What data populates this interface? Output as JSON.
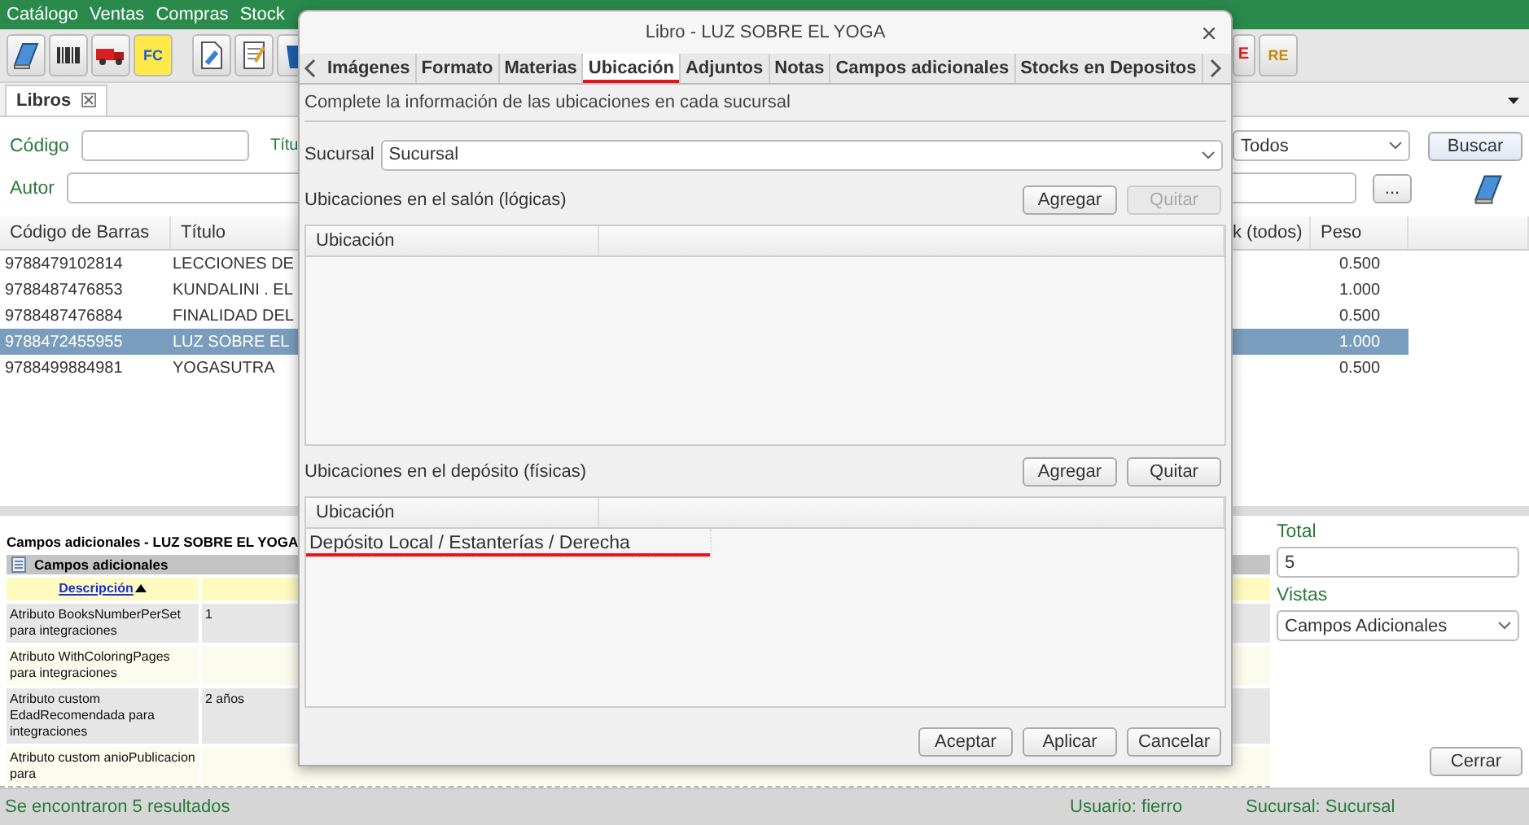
{
  "menu": [
    "Catálogo",
    "Ventas",
    "Compras",
    "Stock"
  ],
  "toolbar": {
    "fc_label": "FC",
    "pe_label": "E",
    "re_label": "RE"
  },
  "doc_tab": {
    "label": "Libros"
  },
  "search": {
    "code_label": "Código",
    "title_label": "Títu",
    "author_label": "Autor",
    "filter_value": "Todos",
    "search_button": "Buscar",
    "more_button": "..."
  },
  "results": {
    "columns": [
      "Código de Barras",
      "Título",
      "k (todos)",
      "Peso"
    ],
    "rows": [
      {
        "barcode": "9788479102814",
        "title": "LECCIONES DE",
        "weight": "0.500",
        "selected": false
      },
      {
        "barcode": "9788487476853",
        "title": "KUNDALINI . EL",
        "weight": "1.000",
        "selected": false
      },
      {
        "barcode": "9788487476884",
        "title": "FINALIDAD DEL",
        "weight": "0.500",
        "selected": false
      },
      {
        "barcode": "9788472455955",
        "title": "LUZ SOBRE EL",
        "weight": "1.000",
        "selected": true
      },
      {
        "barcode": "9788499884981",
        "title": "YOGASUTRA",
        "weight": "0.500",
        "selected": false
      }
    ]
  },
  "extra_fields": {
    "heading": "Campos adicionales - LUZ SOBRE EL YOGA",
    "group_title": "Campos adicionales",
    "column_header": "Descripción",
    "rows": [
      {
        "description": "Atributo BooksNumberPerSet para integraciones",
        "value": "1"
      },
      {
        "description": "Atributo WithColoringPages para integraciones",
        "value": ""
      },
      {
        "description": "Atributo custom EdadRecomendada para integraciones",
        "value": "2 años"
      },
      {
        "description": "Atributo custom anioPublicacion para",
        "value": ""
      }
    ]
  },
  "side_panel": {
    "total_label": "Total",
    "total_value": "5",
    "views_label": "Vistas",
    "views_value": "Campos Adicionales",
    "close_button": "Cerrar"
  },
  "status_bar": {
    "message": "Se encontraron 5 resultados",
    "user": "Usuario: fierro",
    "branch": "Sucursal: Sucursal"
  },
  "dialog": {
    "title": "Libro - LUZ SOBRE EL YOGA",
    "tabs": [
      {
        "label": "Imágenes",
        "selected": false,
        "annotated": false
      },
      {
        "label": "Formato",
        "selected": false,
        "annotated": false
      },
      {
        "label": "Materias",
        "selected": false,
        "annotated": false
      },
      {
        "label": "Ubicación",
        "selected": true,
        "annotated": true
      },
      {
        "label": "Adjuntos",
        "selected": false,
        "annotated": false
      },
      {
        "label": "Notas",
        "selected": false,
        "annotated": false
      },
      {
        "label": "Campos adicionales",
        "selected": false,
        "annotated": false
      },
      {
        "label": "Stocks en Depositos",
        "selected": false,
        "annotated": false
      }
    ],
    "instructions": "Complete la información de las ubicaciones en cada sucursal",
    "branch_label": "Sucursal",
    "branch_value": "Sucursal",
    "sections": [
      {
        "title": "Ubicaciones en el salón (lógicas)",
        "buttons": [
          {
            "label": "Agregar",
            "disabled": false
          },
          {
            "label": "Quitar",
            "disabled": true
          }
        ],
        "column": "Ubicación"
      },
      {
        "title": "Ubicaciones en el depósito (físicas)",
        "buttons": [
          {
            "label": "Agregar",
            "disabled": false
          },
          {
            "label": "Quitar",
            "disabled": false
          }
        ],
        "column": "Ubicación",
        "rows": [
          {
            "text": "Depósito Local / Estanterías / Derecha",
            "annotated": true
          }
        ]
      }
    ],
    "footer_buttons": [
      "Aceptar",
      "Aplicar",
      "Cancelar"
    ]
  }
}
